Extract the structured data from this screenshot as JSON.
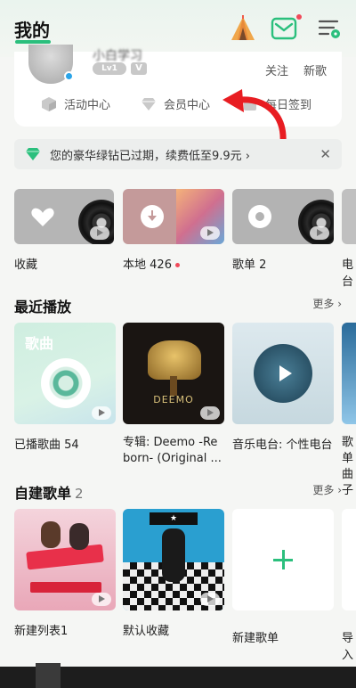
{
  "header": {
    "title": "我的",
    "messages_unread": true
  },
  "profile": {
    "username": "小白学习",
    "level_badge": "Lv1",
    "vip_badge": "V",
    "follow_label": "关注",
    "newsong_label": "新歌",
    "links": [
      {
        "label": "活动中心",
        "icon": "cube-icon"
      },
      {
        "label": "会员中心",
        "icon": "diamond-icon"
      },
      {
        "label": "每日签到",
        "icon": "calendar-icon"
      }
    ]
  },
  "vip_banner": {
    "text": "您的豪华绿钻已过期，续费低至9.9元 ›",
    "close": "✕",
    "accent": "#2bbf7d"
  },
  "quick_tiles": [
    {
      "label": "收藏",
      "count": "",
      "color": "#b5b5b5",
      "icon": "heart-icon"
    },
    {
      "label": "本地",
      "count": "426",
      "color": "#c49a9a",
      "icon": "download-icon"
    },
    {
      "label": "歌单",
      "count": "2",
      "color": "#b3b3b3",
      "icon": "disc-icon"
    },
    {
      "label": "电台",
      "count": "",
      "color": "#c0c0c0",
      "icon": "radio-icon"
    }
  ],
  "recent": {
    "title": "最近播放",
    "more": "更多 ›",
    "items": [
      {
        "cover_text": "歌曲",
        "label": "已播歌曲 54",
        "label2": ""
      },
      {
        "cover_text": "DEEMO",
        "label": "专辑: Deemo -Re",
        "label2": "born- (Original ..."
      },
      {
        "cover_text": "",
        "label": "音乐电台: 个性电台",
        "label2": ""
      },
      {
        "cover_text": "",
        "label": "歌单",
        "label2": "曲子"
      }
    ]
  },
  "playlists": {
    "title": "自建歌单",
    "count": "2",
    "more": "更多 ›",
    "items": [
      {
        "label": "新建列表1"
      },
      {
        "label": "默认收藏"
      },
      {
        "label": "新建歌单"
      },
      {
        "label": "导入"
      }
    ]
  }
}
